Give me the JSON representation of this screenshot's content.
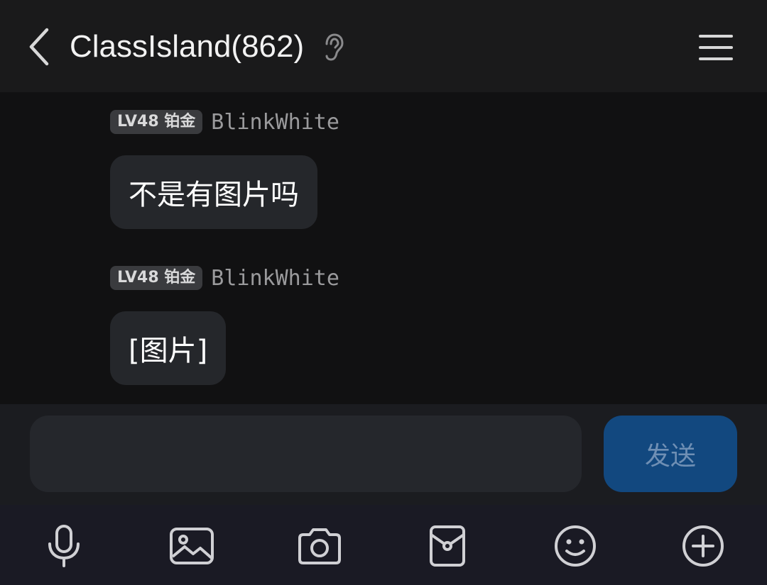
{
  "header": {
    "title": "ClassIsland(862)",
    "icons": {
      "back": "chevron-left-icon",
      "listen": "ear-icon",
      "menu": "hamburger-menu-icon"
    }
  },
  "messages": [
    {
      "badge": "LV48 铂金",
      "sender": "BlinkWhite",
      "text": "不是有图片吗"
    },
    {
      "badge": "LV48 铂金",
      "sender": "BlinkWhite",
      "text": "[图片]"
    }
  ],
  "composer": {
    "placeholder": "",
    "value": "",
    "send_label": "发送",
    "send_color": "#12487f"
  },
  "toolbar": {
    "icons": [
      "microphone-icon",
      "image-icon",
      "camera-icon",
      "red-packet-icon",
      "emoji-icon",
      "add-circle-icon"
    ]
  }
}
